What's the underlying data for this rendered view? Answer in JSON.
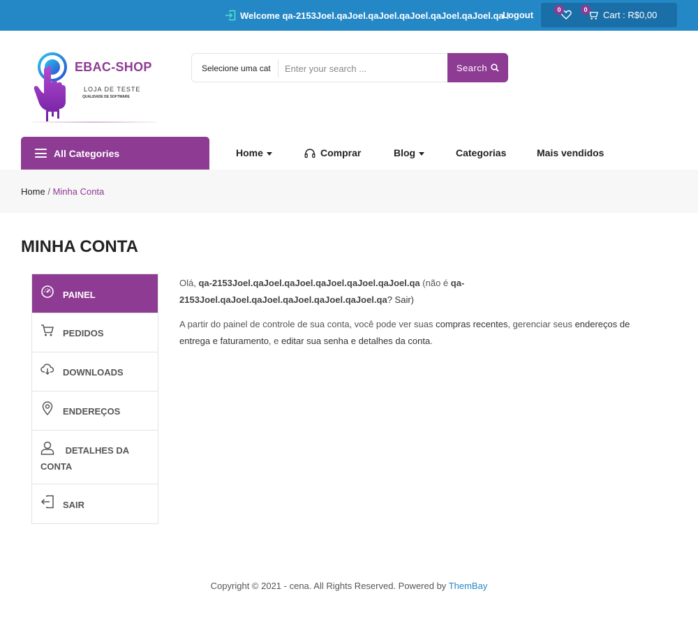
{
  "topbar": {
    "welcome": "Welcome qa-2153Joel.qaJoel.qaJoel.qaJoel.qaJoel.qaJoel.qa !",
    "logout": "Logout",
    "wishlist_count": "0",
    "cart_count": "0",
    "cart_label": "Cart : R$0,00",
    "color": "#2588c6"
  },
  "logo": {
    "title": "EBAC-SHOP",
    "subtitle": "LOJA DE TESTE",
    "tagline": "QUALIDADE DE SOFTWARE"
  },
  "search": {
    "category": "Selecione uma cat",
    "placeholder": "Enter your search ...",
    "button": "Search"
  },
  "nav": {
    "all_categories": "All Categories",
    "items": [
      {
        "label": "Home",
        "dropdown": true
      },
      {
        "label": "Comprar",
        "icon": "headphones-icon"
      },
      {
        "label": "Blog",
        "dropdown": true
      },
      {
        "label": "Categorias"
      },
      {
        "label": "Mais vendidos"
      }
    ]
  },
  "breadcrumb": {
    "home": "Home",
    "separator": "/",
    "current": "Minha Conta"
  },
  "page_title": "MINHA CONTA",
  "account_nav": [
    {
      "label": "Painel",
      "icon": "dashboard-icon",
      "active": true
    },
    {
      "label": "Pedidos",
      "icon": "cart-icon"
    },
    {
      "label": "Downloads",
      "icon": "cloud-download-icon"
    },
    {
      "label": "Endereços",
      "icon": "map-pin-icon"
    },
    {
      "label": "Detalhes da conta",
      "icon": "user-icon"
    },
    {
      "label": "Sair",
      "icon": "logout-icon"
    }
  ],
  "content": {
    "greeting_prefix": "Olá, ",
    "username": "qa-2153Joel.qaJoel.qaJoel.qaJoel.qaJoel.qaJoel.qa",
    "not_prefix": " (não é ",
    "username_again": "qa-2153Joel.qaJoel.qaJoel.qaJoel.qaJoel.qaJoel.qa",
    "sair_suffix": "? Sair)",
    "intro": "A partir do painel de controle de sua conta, você pode ver suas ",
    "link_orders": "compras recentes",
    "mid1": ", gerenciar seus ",
    "link_addresses": "endereços de entrega e faturamento",
    "mid2": ", e ",
    "link_account": "editar sua senha e detalhes da conta",
    "end": "."
  },
  "footer": {
    "text": "Copyright © 2021 - cena. All Rights Reserved. Powered by ",
    "brand": "ThemBay"
  },
  "colors": {
    "accent": "#8e3b93",
    "topbar": "#2588c6",
    "cartbox": "#1a6fa8"
  }
}
